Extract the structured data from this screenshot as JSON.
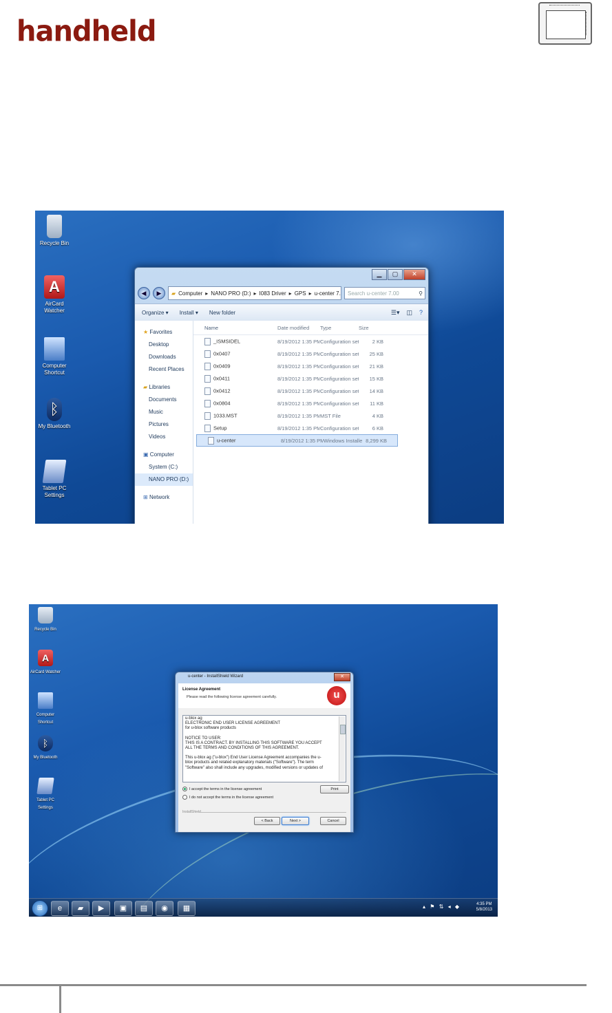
{
  "brand": "handheld",
  "shot1": {
    "desktop_icons": [
      {
        "label": "Recycle Bin",
        "icon": "recycle-bin-icon"
      },
      {
        "label": "AirCard Watcher",
        "icon": "aircard-watcher-icon"
      },
      {
        "label": "Computer Shortcut",
        "icon": "computer-shortcut-icon"
      },
      {
        "label": "My Bluetooth",
        "icon": "bluetooth-icon"
      },
      {
        "label": "Tablet PC Settings",
        "icon": "tablet-pc-settings-icon"
      }
    ],
    "explorer": {
      "breadcrumb": [
        "Computer",
        "NANO PRO (D:)",
        "I083 Driver",
        "GPS",
        "u-center 7.00"
      ],
      "search_placeholder": "Search u-center 7.00",
      "toolbar": {
        "organize": "Organize ▾",
        "install": "Install ▾",
        "new_folder": "New folder"
      },
      "nav": {
        "favorites": "Favorites",
        "favorites_items": [
          "Desktop",
          "Downloads",
          "Recent Places"
        ],
        "libraries": "Libraries",
        "libraries_items": [
          "Documents",
          "Music",
          "Pictures",
          "Videos"
        ],
        "computer": "Computer",
        "computer_items": [
          "System (C:)",
          "NANO PRO (D:)"
        ],
        "network": "Network"
      },
      "columns": [
        "Name",
        "Date modified",
        "Type",
        "Size"
      ],
      "files": [
        {
          "name": "_ISMSIDEL",
          "date": "8/19/2012 1:35 PM",
          "type": "Configuration sett...",
          "size": "2 KB"
        },
        {
          "name": "0x0407",
          "date": "8/19/2012 1:35 PM",
          "type": "Configuration sett...",
          "size": "25 KB"
        },
        {
          "name": "0x0409",
          "date": "8/19/2012 1:35 PM",
          "type": "Configuration sett...",
          "size": "21 KB"
        },
        {
          "name": "0x0411",
          "date": "8/19/2012 1:35 PM",
          "type": "Configuration sett...",
          "size": "15 KB"
        },
        {
          "name": "0x0412",
          "date": "8/19/2012 1:35 PM",
          "type": "Configuration sett...",
          "size": "14 KB"
        },
        {
          "name": "0x0804",
          "date": "8/19/2012 1:35 PM",
          "type": "Configuration sett...",
          "size": "11 KB"
        },
        {
          "name": "1033.MST",
          "date": "8/19/2012 1:35 PM",
          "type": "MST File",
          "size": "4 KB"
        },
        {
          "name": "Setup",
          "date": "8/19/2012 1:35 PM",
          "type": "Configuration sett...",
          "size": "6 KB"
        },
        {
          "name": "u-center",
          "date": "8/19/2012 1:35 PM",
          "type": "Windows Installer ...",
          "size": "8,299 KB"
        }
      ]
    }
  },
  "shot2": {
    "desktop_icons": [
      {
        "label": "Recycle Bin",
        "icon": "recycle-bin-icon"
      },
      {
        "label": "AirCard Watcher",
        "icon": "aircard-watcher-icon"
      },
      {
        "label": "Computer Shortcut",
        "icon": "computer-shortcut-icon"
      },
      {
        "label": "My Bluetooth",
        "icon": "bluetooth-icon"
      },
      {
        "label": "Tablet PC Settings",
        "icon": "tablet-pc-settings-icon"
      }
    ],
    "dialog": {
      "title": "u-center - InstallShield Wizard",
      "heading": "License Agreement",
      "subheading": "Please read the following license agreement carefully.",
      "logo_letter": "u",
      "license_lines": [
        "u-blox ag",
        "ELECTRONIC END USER LICENSE AGREEMENT",
        "for u-blox software products",
        "",
        "NOTICE TO USER:",
        "THIS IS A CONTRACT.  BY INSTALLING THIS SOFTWARE YOU ACCEPT",
        "ALL THE TERMS AND CONDITIONS OF THIS AGREEMENT.",
        "",
        "This u-blox ag (\"u-blox\") End User License Agreement accompanies the u-",
        "blox products and related explanatory materials (\"Software\").  The term",
        "\"Software\" also shall include any upgrades, modified versions or updates of"
      ],
      "accept": "I accept the terms in the license agreement",
      "decline": "I do not accept the terms in the license agreement",
      "print": "Print",
      "installshield": "InstallShield",
      "back": "< Back",
      "next": "Next >",
      "cancel": "Cancel"
    },
    "taskbar": {
      "tray": "▴ ⚑ ⇅ ◂ ◆",
      "time": "4:35 PM",
      "date": "5/8/2013"
    }
  }
}
